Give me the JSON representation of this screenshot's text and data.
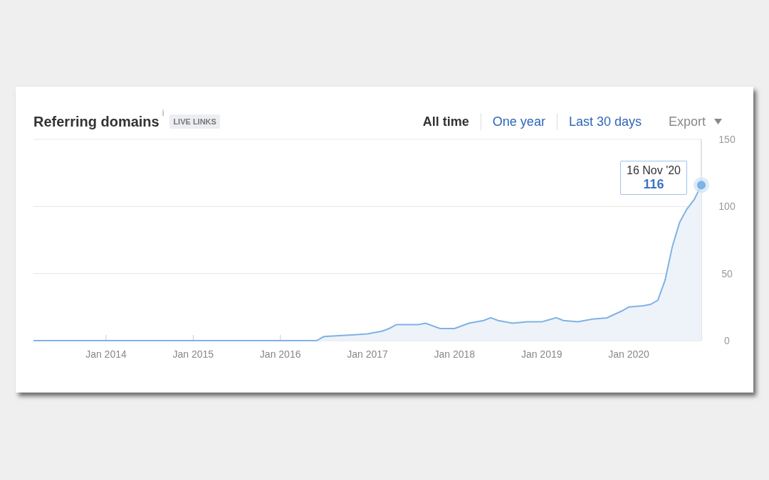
{
  "title": "Referring domains",
  "info_mark": "i",
  "badge": "LIVE LINKS",
  "ranges": [
    {
      "label": "All time",
      "selected": true
    },
    {
      "label": "One year",
      "selected": false
    },
    {
      "label": "Last 30 days",
      "selected": false
    }
  ],
  "export": {
    "label": "Export"
  },
  "chart_data": {
    "type": "area",
    "xlim": [
      "2013-03",
      "2020-11"
    ],
    "ylim": [
      0,
      150
    ],
    "xticks": [
      {
        "value": "2014-01",
        "label": "Jan 2014"
      },
      {
        "value": "2015-01",
        "label": "Jan 2015"
      },
      {
        "value": "2016-01",
        "label": "Jan 2016"
      },
      {
        "value": "2017-01",
        "label": "Jan 2017"
      },
      {
        "value": "2018-01",
        "label": "Jan 2018"
      },
      {
        "value": "2019-01",
        "label": "Jan 2019"
      },
      {
        "value": "2020-01",
        "label": "Jan 2020"
      }
    ],
    "yticks": [
      0,
      50,
      100,
      150
    ],
    "x": [
      "2013-03",
      "2016-06",
      "2016-07",
      "2016-10",
      "2017-01",
      "2017-03",
      "2017-04",
      "2017-05",
      "2017-08",
      "2017-09",
      "2017-11",
      "2018-01",
      "2018-02",
      "2018-03",
      "2018-05",
      "2018-06",
      "2018-07",
      "2018-09",
      "2018-11",
      "2019-01",
      "2019-03",
      "2019-04",
      "2019-06",
      "2019-08",
      "2019-10",
      "2019-12",
      "2020-01",
      "2020-03",
      "2020-04",
      "2020-05",
      "2020-06",
      "2020-07",
      "2020-08",
      "2020-09",
      "2020-10",
      "2020-11"
    ],
    "series": [
      {
        "color": "#7fb2e5",
        "values": [
          0,
          0,
          3,
          4,
          5,
          7,
          9,
          12,
          12,
          13,
          9,
          9,
          11,
          13,
          15,
          17,
          15,
          13,
          14,
          14,
          17,
          15,
          14,
          16,
          17,
          22,
          25,
          26,
          27,
          30,
          45,
          70,
          88,
          98,
          105,
          116
        ]
      }
    ]
  },
  "tooltip": {
    "date": "16 Nov '20",
    "value": "116"
  }
}
